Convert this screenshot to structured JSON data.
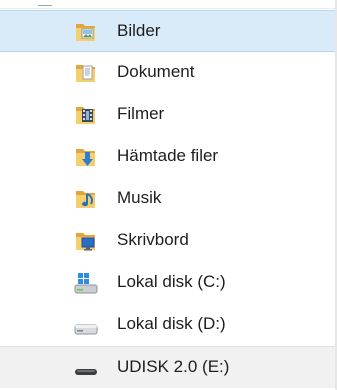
{
  "nav": {
    "items": [
      {
        "label": "Bilder",
        "icon": "pictures-folder-icon",
        "selected": true
      },
      {
        "label": "Dokument",
        "icon": "documents-folder-icon",
        "selected": false
      },
      {
        "label": "Filmer",
        "icon": "videos-folder-icon",
        "selected": false
      },
      {
        "label": "Hämtade filer",
        "icon": "downloads-folder-icon",
        "selected": false
      },
      {
        "label": "Musik",
        "icon": "music-folder-icon",
        "selected": false
      },
      {
        "label": "Skrivbord",
        "icon": "desktop-folder-icon",
        "selected": false
      },
      {
        "label": "Lokal disk (C:)",
        "icon": "system-drive-icon",
        "selected": false
      },
      {
        "label": "Lokal disk (D:)",
        "icon": "hard-drive-icon",
        "selected": false
      },
      {
        "label": "UDISK 2.0 (E:)",
        "icon": "usb-drive-icon",
        "selected": false
      }
    ]
  },
  "colors": {
    "selection_bg": "#d9ebf9",
    "selection_border": "#bad6ef",
    "folder": "#e8b64a",
    "text": "#1e1e1e"
  }
}
